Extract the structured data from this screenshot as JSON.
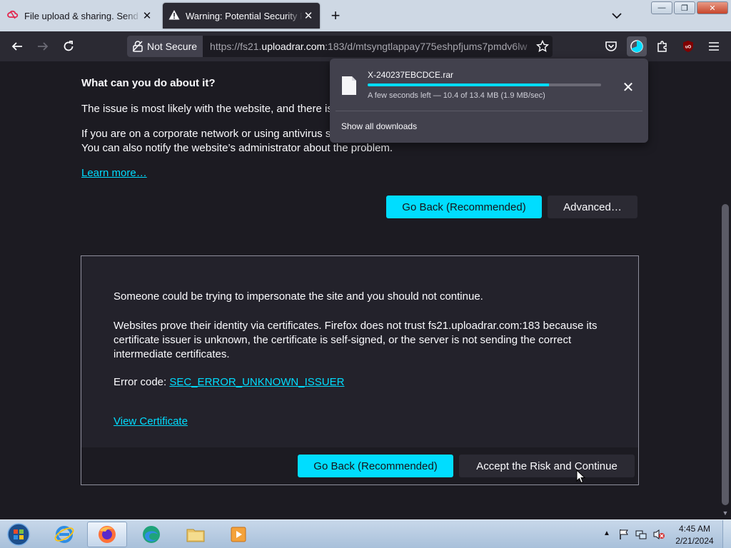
{
  "tabs": [
    {
      "title": "File upload & sharing. Send large files",
      "close": "✕"
    },
    {
      "title": "Warning: Potential Security Risk Ahead",
      "close": "✕"
    }
  ],
  "new_tab": "+",
  "window_controls": {
    "minimize": "—",
    "restore": "❐",
    "close": "✕"
  },
  "nav": {
    "not_secure_label": "Not Secure",
    "url_prefix": "https://fs21.",
    "url_host": "uploadrar.com",
    "url_rest": ":183/d/mtsyngtlappay775eshpfjums7pmdv6lw"
  },
  "page": {
    "heading": "What can you do about it?",
    "para1": "The issue is most likely with the website, and there is",
    "para2_line1": "If you are on a corporate network or using antivirus s",
    "para2_line2": "You can also notify the website’s administrator about the problem.",
    "learn_more": "Learn more…",
    "go_back": "Go Back (Recommended)",
    "advanced": "Advanced…",
    "adv_p1": "Someone could be trying to impersonate the site and you should not continue.",
    "adv_p2": "Websites prove their identity via certificates. Firefox does not trust fs21.uploadrar.com:183 because its certificate issuer is unknown, the certificate is self-signed, or the server is not sending the correct intermediate certificates.",
    "error_code_label": "Error code:",
    "error_code": "SEC_ERROR_UNKNOWN_ISSUER",
    "view_certificate": "View Certificate",
    "go_back_2": "Go Back (Recommended)",
    "accept": "Accept the Risk and Continue"
  },
  "download": {
    "filename": "X-240237EBCDCE.rar",
    "status": "A few seconds left — 10.4 of 13.4 MB (1.9 MB/sec)",
    "progress": 0.776,
    "show_all": "Show all downloads",
    "close": "✕"
  },
  "taskbar": {
    "time": "4:45 AM",
    "date": "2/21/2024"
  },
  "colors": {
    "accent": "#00ddff",
    "bg": "#1c1b22",
    "toolbar": "#2b2a33"
  }
}
